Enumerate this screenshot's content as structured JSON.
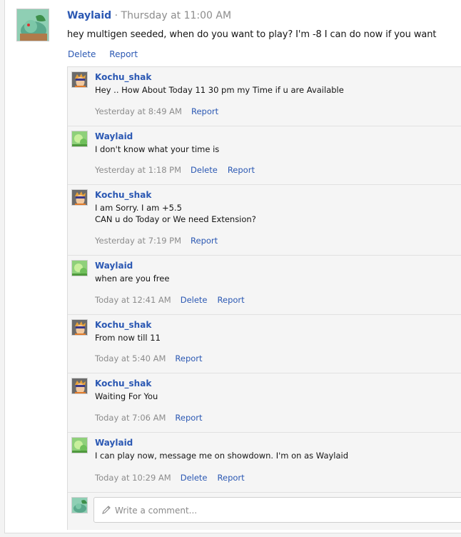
{
  "post": {
    "author": "Waylaid",
    "separator": "·",
    "time": "Thursday at 11:00 AM",
    "text": "hey multigen seeded, when do you want to play? I'm -8 I can do now if you want",
    "actions": [
      "Delete",
      "Report"
    ]
  },
  "comments": [
    {
      "author": "Kochu_shak",
      "avatar": "kochu-avatar",
      "lines": [
        "Hey .. How About Today 11 30 pm my Time if u are Available"
      ],
      "time": "Yesterday at 8:49 AM",
      "actions": [
        "Report"
      ]
    },
    {
      "author": "Waylaid",
      "avatar": "waylaid-avatar",
      "lines": [
        "I don't know what your time is"
      ],
      "time": "Yesterday at 1:18 PM",
      "actions": [
        "Delete",
        "Report"
      ]
    },
    {
      "author": "Kochu_shak",
      "avatar": "kochu-avatar",
      "lines": [
        "I am Sorry. I am +5.5",
        "CAN u do Today or We need Extension?"
      ],
      "time": "Yesterday at 7:19 PM",
      "actions": [
        "Report"
      ]
    },
    {
      "author": "Waylaid",
      "avatar": "waylaid-avatar",
      "lines": [
        "when are you free"
      ],
      "time": "Today at 12:41 AM",
      "actions": [
        "Delete",
        "Report"
      ]
    },
    {
      "author": "Kochu_shak",
      "avatar": "kochu-avatar",
      "lines": [
        "From now till 11"
      ],
      "time": "Today at 5:40 AM",
      "actions": [
        "Report"
      ]
    },
    {
      "author": "Kochu_shak",
      "avatar": "kochu-avatar",
      "lines": [
        "Waiting For You"
      ],
      "time": "Today at 7:06 AM",
      "actions": [
        "Report"
      ]
    },
    {
      "author": "Waylaid",
      "avatar": "waylaid-avatar",
      "lines": [
        "I can play now, message me on showdown. I'm on as Waylaid"
      ],
      "time": "Today at 10:29 AM",
      "actions": [
        "Delete",
        "Report"
      ]
    }
  ],
  "compose": {
    "placeholder": "Write a comment...",
    "icon": "pencil-icon"
  },
  "colors": {
    "link": "#2b58b3",
    "muted": "#8c8c8c",
    "thread_bg": "#f5f5f5"
  }
}
